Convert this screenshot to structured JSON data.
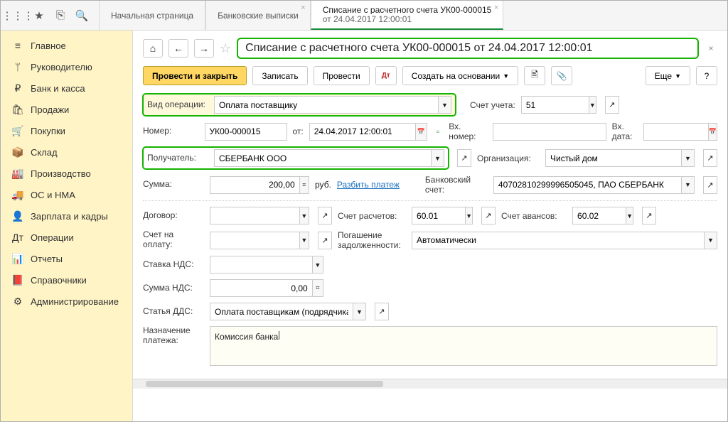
{
  "topIcons": [
    "grid",
    "star",
    "copy",
    "search"
  ],
  "tabs": [
    {
      "title": "Начальная страница",
      "active": false,
      "closable": false
    },
    {
      "title": "Банковские выписки",
      "active": false,
      "closable": true
    },
    {
      "title": "Списание с расчетного счета УК00-000015",
      "sub": "от 24.04.2017 12:00:01",
      "active": true,
      "closable": true
    }
  ],
  "sidebar": [
    {
      "icon": "≡",
      "label": "Главное"
    },
    {
      "icon": "ᛘ",
      "label": "Руководителю"
    },
    {
      "icon": "₽",
      "label": "Банк и касса"
    },
    {
      "icon": "🛍",
      "label": "Продажи"
    },
    {
      "icon": "🛒",
      "label": "Покупки"
    },
    {
      "icon": "📦",
      "label": "Склад"
    },
    {
      "icon": "🏭",
      "label": "Производство"
    },
    {
      "icon": "🚚",
      "label": "ОС и НМА"
    },
    {
      "icon": "👤",
      "label": "Зарплата и кадры"
    },
    {
      "icon": "Дт",
      "label": "Операции"
    },
    {
      "icon": "📊",
      "label": "Отчеты"
    },
    {
      "icon": "📕",
      "label": "Справочники"
    },
    {
      "icon": "⚙",
      "label": "Администрирование"
    }
  ],
  "doc": {
    "title": "Списание с расчетного счета УК00-000015 от 24.04.2017 12:00:01",
    "toolbar": {
      "post_close": "Провести и закрыть",
      "save": "Записать",
      "post": "Провести",
      "create_based": "Создать на основании",
      "more": "Еще"
    },
    "labels": {
      "op_type": "Вид операции:",
      "account": "Счет учета:",
      "number": "Номер:",
      "date_prefix": "от:",
      "in_number": "Вх. номер:",
      "in_date": "Вх. дата:",
      "recipient": "Получатель:",
      "org": "Организация:",
      "amount": "Сумма:",
      "currency": "руб.",
      "split_link": "Разбить платеж",
      "bank_account": "Банковский счет:",
      "contract": "Договор:",
      "settle_account": "Счет расчетов:",
      "advance_account": "Счет авансов:",
      "payment_account": "Счет на оплату:",
      "debt_settle": "Погашение задолженности:",
      "vat_rate": "Ставка НДС:",
      "vat_amount": "Сумма НДС:",
      "dds": "Статья ДДС:",
      "purpose": "Назначение платежа:"
    },
    "values": {
      "op_type": "Оплата поставщику",
      "account": "51",
      "number": "УК00-000015",
      "date": "24.04.2017 12:00:01",
      "in_number": "",
      "in_date": "",
      "recipient": "СБЕРБАНК ООО",
      "org": "Чистый дом",
      "amount": "200,00",
      "bank_account": "40702810299996505045, ПАО СБЕРБАНК",
      "contract": "",
      "settle_account": "60.01",
      "advance_account": "60.02",
      "payment_account": "",
      "debt_settle": "Автоматически",
      "vat_rate": "",
      "vat_amount": "0,00",
      "dds": "Оплата поставщикам (подрядчикам)",
      "purpose": "Комиссия банка"
    }
  }
}
